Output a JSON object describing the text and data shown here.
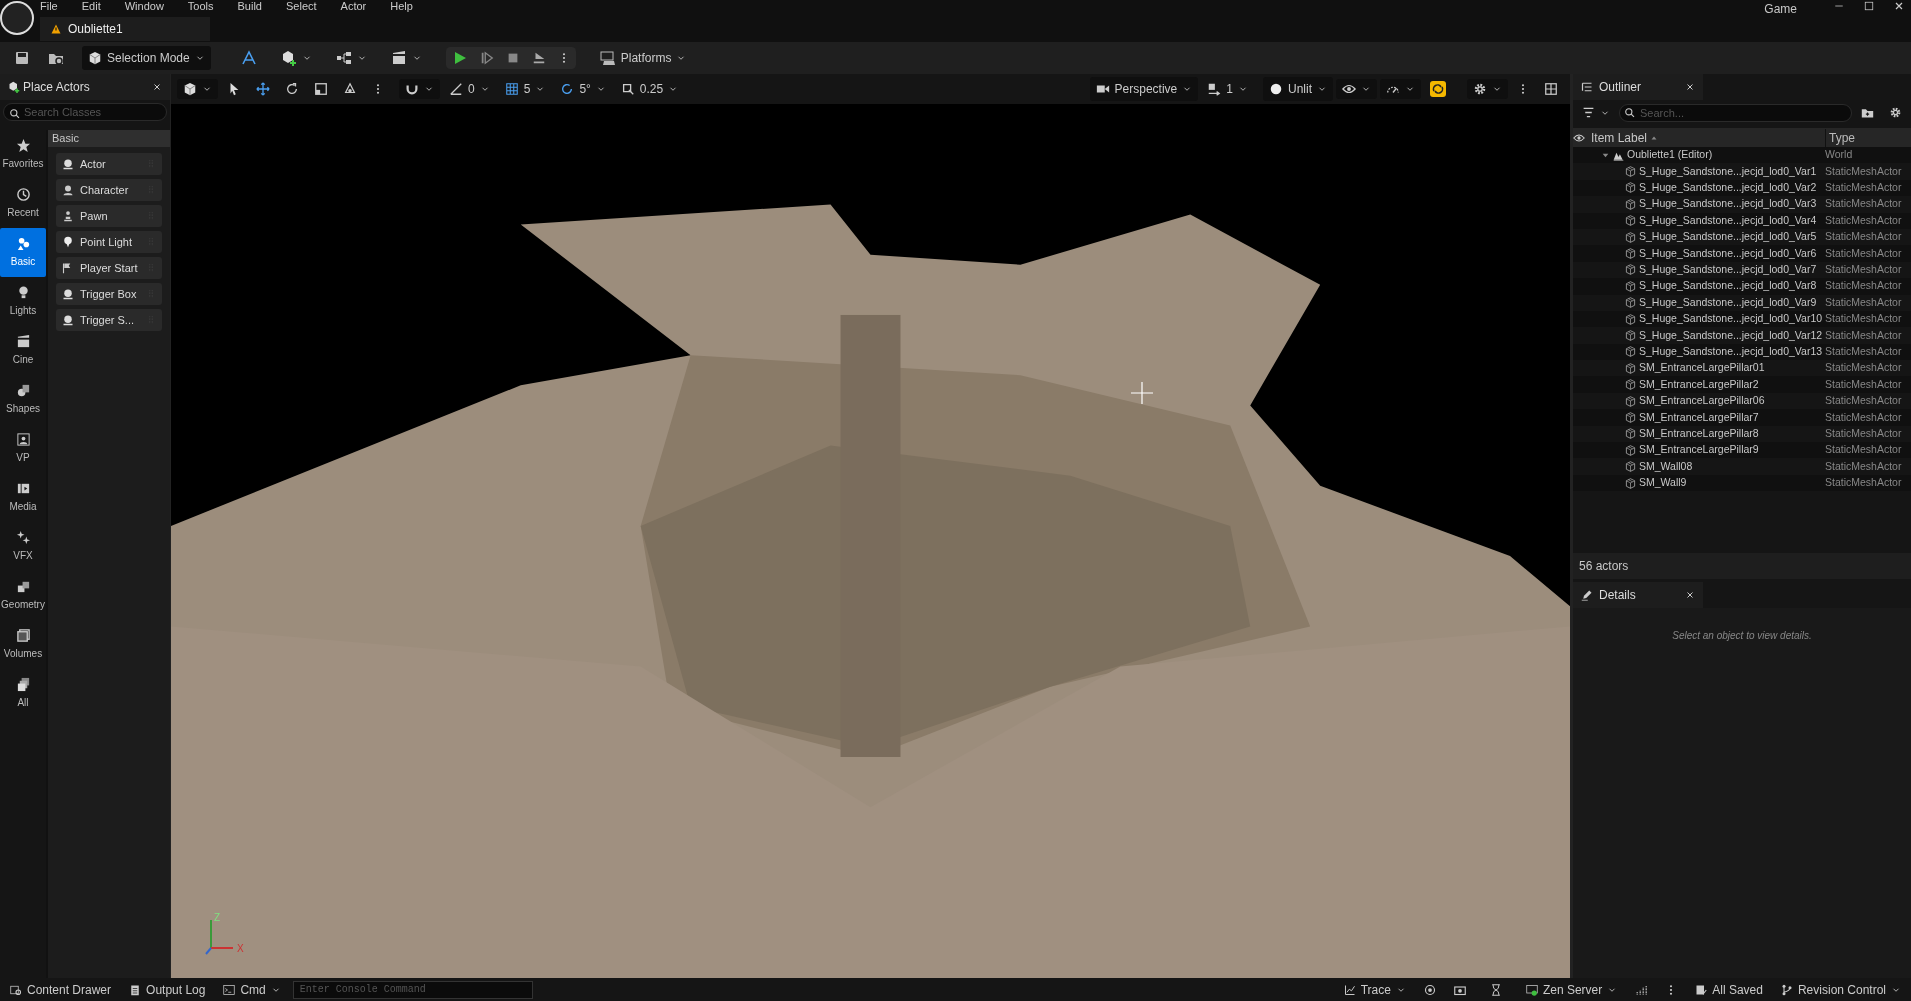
{
  "title_bar": {
    "menu": [
      "File",
      "Edit",
      "Window",
      "Tools",
      "Build",
      "Select",
      "Actor",
      "Help"
    ],
    "tab": "Oubliette1",
    "game_label": "Game"
  },
  "toolbar": {
    "mode": "Selection Mode",
    "platforms": "Platforms"
  },
  "place_actors": {
    "title": "Place Actors",
    "search_placeholder": "Search Classes",
    "categories": [
      {
        "label": "Favorites",
        "selected": false
      },
      {
        "label": "Recent",
        "selected": false
      },
      {
        "label": "Basic",
        "selected": true
      },
      {
        "label": "Lights",
        "selected": false
      },
      {
        "label": "Cine",
        "selected": false
      },
      {
        "label": "Shapes",
        "selected": false
      },
      {
        "label": "VP",
        "selected": false
      },
      {
        "label": "Media",
        "selected": false
      },
      {
        "label": "VFX",
        "selected": false
      },
      {
        "label": "Geometry",
        "selected": false
      },
      {
        "label": "Volumes",
        "selected": false
      },
      {
        "label": "All",
        "selected": false
      }
    ],
    "section": "Basic",
    "items": [
      "Actor",
      "Character",
      "Pawn",
      "Point Light",
      "Player Start",
      "Trigger Box",
      "Trigger S..."
    ]
  },
  "viewport": {
    "snap_angle": "0",
    "grid_snap": "5",
    "rotation_snap": "5°",
    "scale_snap": "0.25",
    "view_mode": "Perspective",
    "camera_speed": "1",
    "lighting": "Unlit",
    "axis_labels": [
      "Z",
      "X"
    ]
  },
  "outliner": {
    "title": "Outliner",
    "search_placeholder": "Search...",
    "columns": [
      "Item Label",
      "Type"
    ],
    "root": {
      "label": "Oubliette1 (Editor)",
      "type": "World",
      "expanded": true,
      "children": [
        {
          "label": "S_Huge_Sandstone...jecjd_lod0_Var1",
          "type": "StaticMeshActor"
        },
        {
          "label": "S_Huge_Sandstone...jecjd_lod0_Var2",
          "type": "StaticMeshActor"
        },
        {
          "label": "S_Huge_Sandstone...jecjd_lod0_Var3",
          "type": "StaticMeshActor"
        },
        {
          "label": "S_Huge_Sandstone...jecjd_lod0_Var4",
          "type": "StaticMeshActor"
        },
        {
          "label": "S_Huge_Sandstone...jecjd_lod0_Var5",
          "type": "StaticMeshActor"
        },
        {
          "label": "S_Huge_Sandstone...jecjd_lod0_Var6",
          "type": "StaticMeshActor"
        },
        {
          "label": "S_Huge_Sandstone...jecjd_lod0_Var7",
          "type": "StaticMeshActor"
        },
        {
          "label": "S_Huge_Sandstone...jecjd_lod0_Var8",
          "type": "StaticMeshActor"
        },
        {
          "label": "S_Huge_Sandstone...jecjd_lod0_Var9",
          "type": "StaticMeshActor"
        },
        {
          "label": "S_Huge_Sandstone...jecjd_lod0_Var10",
          "type": "StaticMeshActor"
        },
        {
          "label": "S_Huge_Sandstone...jecjd_lod0_Var12",
          "type": "StaticMeshActor"
        },
        {
          "label": "S_Huge_Sandstone...jecjd_lod0_Var13",
          "type": "StaticMeshActor"
        },
        {
          "label": "SM_EntranceLargePillar01",
          "type": "StaticMeshActor"
        },
        {
          "label": "SM_EntranceLargePillar2",
          "type": "StaticMeshActor"
        },
        {
          "label": "SM_EntranceLargePillar06",
          "type": "StaticMeshActor"
        },
        {
          "label": "SM_EntranceLargePillar7",
          "type": "StaticMeshActor"
        },
        {
          "label": "SM_EntranceLargePillar8",
          "type": "StaticMeshActor"
        },
        {
          "label": "SM_EntranceLargePillar9",
          "type": "StaticMeshActor"
        },
        {
          "label": "SM_Wall08",
          "type": "StaticMeshActor"
        },
        {
          "label": "SM_Wall9",
          "type": "StaticMeshActor"
        }
      ]
    },
    "count": "56 actors"
  },
  "details": {
    "title": "Details",
    "empty_message": "Select an object to view details."
  },
  "status_bar": {
    "content_drawer": "Content Drawer",
    "output_log": "Output Log",
    "cmd": "Cmd",
    "console_placeholder": "Enter Console Command",
    "trace": "Trace",
    "zen_server": "Zen Server",
    "saved": "All Saved",
    "revision_control": "Revision Control"
  }
}
